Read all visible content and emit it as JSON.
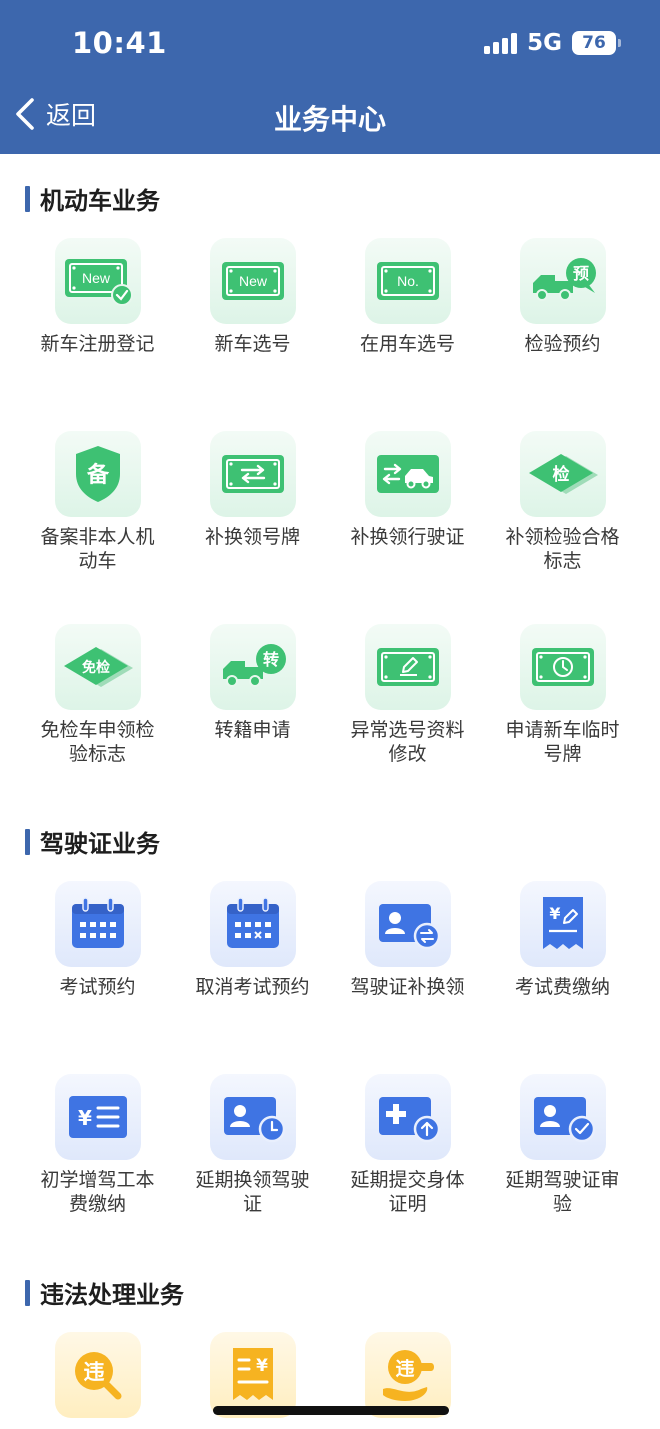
{
  "status_bar": {
    "time": "10:41",
    "network": "5G",
    "battery": "76"
  },
  "nav": {
    "back_label": "返回",
    "title": "业务中心"
  },
  "colors": {
    "header": "#3d67ad",
    "green": "#3ec173",
    "blue": "#3f74e3",
    "orange": "#f6b321"
  },
  "sections": [
    {
      "title": "机动车业务",
      "items": [
        {
          "label": "新车注册登记",
          "icon": "new-plate-check-icon"
        },
        {
          "label": "新车选号",
          "icon": "new-plate-icon"
        },
        {
          "label": "在用车选号",
          "icon": "number-plate-icon"
        },
        {
          "label": "检验预约",
          "icon": "truck-appointment-icon"
        },
        {
          "label": "备案非本人机动车",
          "icon": "shield-record-icon"
        },
        {
          "label": "补换领号牌",
          "icon": "plate-exchange-icon"
        },
        {
          "label": "补换领行驶证",
          "icon": "car-exchange-icon"
        },
        {
          "label": "补领检验合格标志",
          "icon": "inspection-diamond-icon"
        },
        {
          "label": "免检车申领检验标志",
          "icon": "exempt-diamond-icon"
        },
        {
          "label": "转籍申请",
          "icon": "truck-transfer-icon"
        },
        {
          "label": "异常选号资料修改",
          "icon": "plate-edit-icon"
        },
        {
          "label": "申请新车临时号牌",
          "icon": "plate-clock-icon"
        }
      ]
    },
    {
      "title": "驾驶证业务",
      "items": [
        {
          "label": "考试预约",
          "icon": "calendar-icon"
        },
        {
          "label": "取消考试预约",
          "icon": "calendar-cancel-icon"
        },
        {
          "label": "驾驶证补换领",
          "icon": "license-exchange-icon"
        },
        {
          "label": "考试费缴纳",
          "icon": "fee-receipt-icon"
        },
        {
          "label": "初学增驾工本费缴纳",
          "icon": "fee-list-icon"
        },
        {
          "label": "延期换领驾驶证",
          "icon": "license-clock-icon"
        },
        {
          "label": "延期提交身体证明",
          "icon": "medical-upload-icon"
        },
        {
          "label": "延期驾驶证审验",
          "icon": "license-check-icon"
        }
      ]
    },
    {
      "title": "违法处理业务",
      "items": [
        {
          "label": "",
          "icon": "violation-search-icon"
        },
        {
          "label": "",
          "icon": "fine-receipt-icon"
        },
        {
          "label": "",
          "icon": "violation-hand-icon"
        }
      ]
    }
  ],
  "glyphs": {
    "new": "New",
    "no": "No.",
    "yu": "预",
    "bei": "备",
    "jian": "检",
    "mianjian": "免检",
    "zhuan": "转",
    "yen": "¥",
    "wei": "违"
  }
}
